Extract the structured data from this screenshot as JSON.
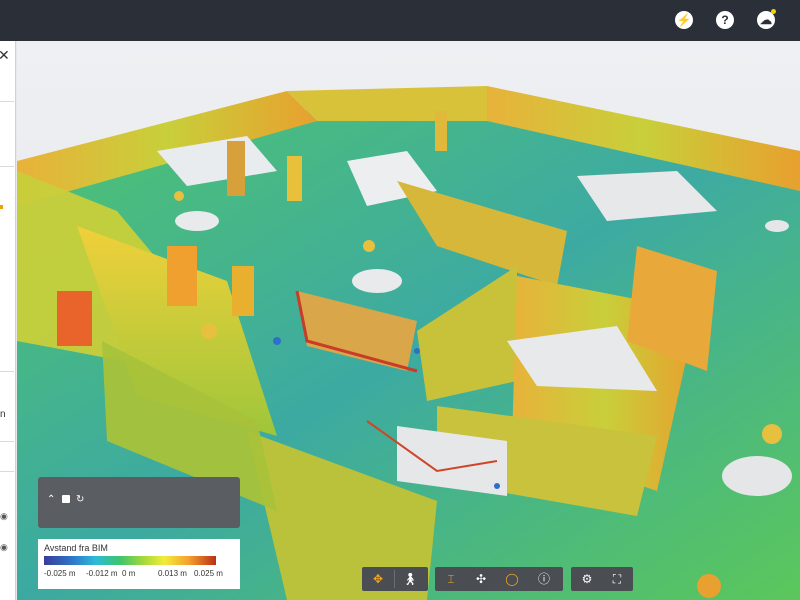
{
  "topbar": {
    "icons": [
      "lightning-icon",
      "help-icon",
      "account-cloud-icon"
    ],
    "notification_color": "#f5d000"
  },
  "legend": {
    "title": "Avstand fra BIM",
    "ticks": [
      "-0.025 m",
      "-0.012 m",
      "0 m",
      "0.013 m",
      "0.025 m"
    ],
    "colors": [
      "#3a3c9a",
      "#2e75c9",
      "#2dbbd8",
      "#3ec46d",
      "#a5d93a",
      "#f3ec3a",
      "#f5a12e",
      "#b93018"
    ]
  },
  "layer_box": {
    "icons": [
      "chevron-up-icon",
      "checkbox-icon",
      "refresh-icon"
    ],
    "checked": true
  },
  "toolbar": {
    "groups": [
      [
        "orbit-icon",
        "walk-icon"
      ],
      [
        "measure-icon",
        "move-icon",
        "circle-icon",
        "info-icon"
      ],
      [
        "settings-icon",
        "fullscreen-icon"
      ]
    ],
    "active_color": "#f5a623"
  },
  "side_panel": {
    "fragment": "n"
  }
}
